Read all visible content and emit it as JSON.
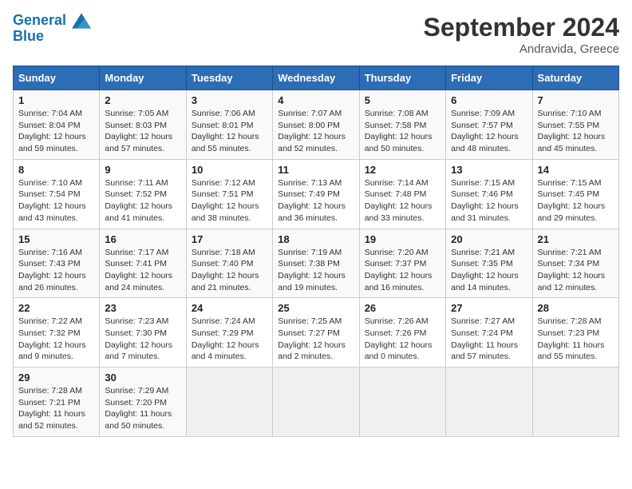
{
  "header": {
    "logo_line1": "General",
    "logo_line2": "Blue",
    "month_title": "September 2024",
    "location": "Andravida, Greece"
  },
  "weekdays": [
    "Sunday",
    "Monday",
    "Tuesday",
    "Wednesday",
    "Thursday",
    "Friday",
    "Saturday"
  ],
  "weeks": [
    [
      {
        "day": "1",
        "info": "Sunrise: 7:04 AM\nSunset: 8:04 PM\nDaylight: 12 hours\nand 59 minutes."
      },
      {
        "day": "2",
        "info": "Sunrise: 7:05 AM\nSunset: 8:03 PM\nDaylight: 12 hours\nand 57 minutes."
      },
      {
        "day": "3",
        "info": "Sunrise: 7:06 AM\nSunset: 8:01 PM\nDaylight: 12 hours\nand 55 minutes."
      },
      {
        "day": "4",
        "info": "Sunrise: 7:07 AM\nSunset: 8:00 PM\nDaylight: 12 hours\nand 52 minutes."
      },
      {
        "day": "5",
        "info": "Sunrise: 7:08 AM\nSunset: 7:58 PM\nDaylight: 12 hours\nand 50 minutes."
      },
      {
        "day": "6",
        "info": "Sunrise: 7:09 AM\nSunset: 7:57 PM\nDaylight: 12 hours\nand 48 minutes."
      },
      {
        "day": "7",
        "info": "Sunrise: 7:10 AM\nSunset: 7:55 PM\nDaylight: 12 hours\nand 45 minutes."
      }
    ],
    [
      {
        "day": "8",
        "info": "Sunrise: 7:10 AM\nSunset: 7:54 PM\nDaylight: 12 hours\nand 43 minutes."
      },
      {
        "day": "9",
        "info": "Sunrise: 7:11 AM\nSunset: 7:52 PM\nDaylight: 12 hours\nand 41 minutes."
      },
      {
        "day": "10",
        "info": "Sunrise: 7:12 AM\nSunset: 7:51 PM\nDaylight: 12 hours\nand 38 minutes."
      },
      {
        "day": "11",
        "info": "Sunrise: 7:13 AM\nSunset: 7:49 PM\nDaylight: 12 hours\nand 36 minutes."
      },
      {
        "day": "12",
        "info": "Sunrise: 7:14 AM\nSunset: 7:48 PM\nDaylight: 12 hours\nand 33 minutes."
      },
      {
        "day": "13",
        "info": "Sunrise: 7:15 AM\nSunset: 7:46 PM\nDaylight: 12 hours\nand 31 minutes."
      },
      {
        "day": "14",
        "info": "Sunrise: 7:15 AM\nSunset: 7:45 PM\nDaylight: 12 hours\nand 29 minutes."
      }
    ],
    [
      {
        "day": "15",
        "info": "Sunrise: 7:16 AM\nSunset: 7:43 PM\nDaylight: 12 hours\nand 26 minutes."
      },
      {
        "day": "16",
        "info": "Sunrise: 7:17 AM\nSunset: 7:41 PM\nDaylight: 12 hours\nand 24 minutes."
      },
      {
        "day": "17",
        "info": "Sunrise: 7:18 AM\nSunset: 7:40 PM\nDaylight: 12 hours\nand 21 minutes."
      },
      {
        "day": "18",
        "info": "Sunrise: 7:19 AM\nSunset: 7:38 PM\nDaylight: 12 hours\nand 19 minutes."
      },
      {
        "day": "19",
        "info": "Sunrise: 7:20 AM\nSunset: 7:37 PM\nDaylight: 12 hours\nand 16 minutes."
      },
      {
        "day": "20",
        "info": "Sunrise: 7:21 AM\nSunset: 7:35 PM\nDaylight: 12 hours\nand 14 minutes."
      },
      {
        "day": "21",
        "info": "Sunrise: 7:21 AM\nSunset: 7:34 PM\nDaylight: 12 hours\nand 12 minutes."
      }
    ],
    [
      {
        "day": "22",
        "info": "Sunrise: 7:22 AM\nSunset: 7:32 PM\nDaylight: 12 hours\nand 9 minutes."
      },
      {
        "day": "23",
        "info": "Sunrise: 7:23 AM\nSunset: 7:30 PM\nDaylight: 12 hours\nand 7 minutes."
      },
      {
        "day": "24",
        "info": "Sunrise: 7:24 AM\nSunset: 7:29 PM\nDaylight: 12 hours\nand 4 minutes."
      },
      {
        "day": "25",
        "info": "Sunrise: 7:25 AM\nSunset: 7:27 PM\nDaylight: 12 hours\nand 2 minutes."
      },
      {
        "day": "26",
        "info": "Sunrise: 7:26 AM\nSunset: 7:26 PM\nDaylight: 12 hours\nand 0 minutes."
      },
      {
        "day": "27",
        "info": "Sunrise: 7:27 AM\nSunset: 7:24 PM\nDaylight: 11 hours\nand 57 minutes."
      },
      {
        "day": "28",
        "info": "Sunrise: 7:28 AM\nSunset: 7:23 PM\nDaylight: 11 hours\nand 55 minutes."
      }
    ],
    [
      {
        "day": "29",
        "info": "Sunrise: 7:28 AM\nSunset: 7:21 PM\nDaylight: 11 hours\nand 52 minutes."
      },
      {
        "day": "30",
        "info": "Sunrise: 7:29 AM\nSunset: 7:20 PM\nDaylight: 11 hours\nand 50 minutes."
      },
      {
        "day": "",
        "info": ""
      },
      {
        "day": "",
        "info": ""
      },
      {
        "day": "",
        "info": ""
      },
      {
        "day": "",
        "info": ""
      },
      {
        "day": "",
        "info": ""
      }
    ]
  ]
}
